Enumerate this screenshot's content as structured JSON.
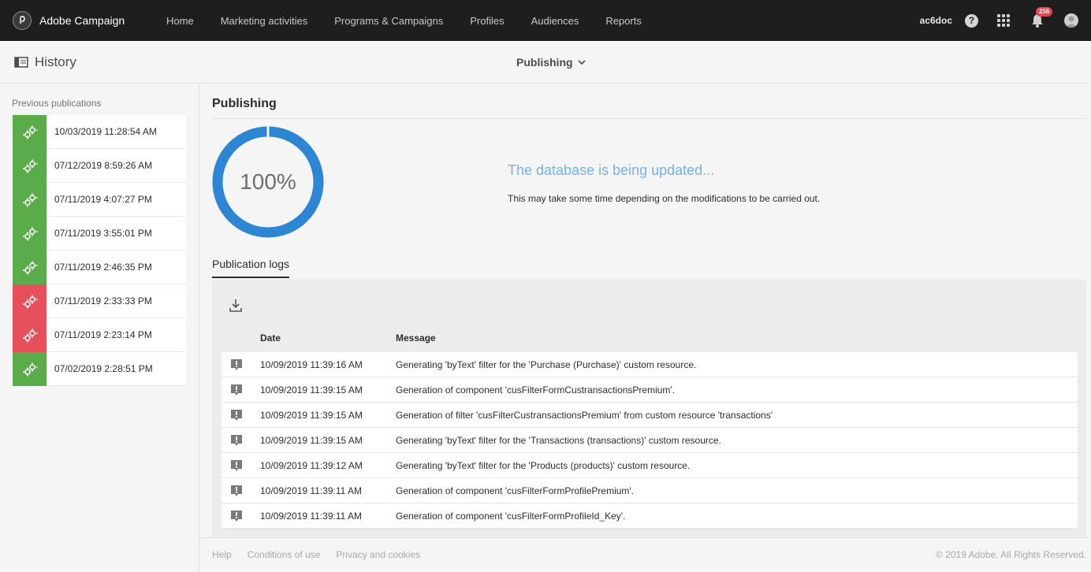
{
  "app": {
    "brand": "Adobe Campaign",
    "nav": [
      "Home",
      "Marketing activities",
      "Programs & Campaigns",
      "Profiles",
      "Audiences",
      "Reports"
    ],
    "user_code": "ac6doc",
    "help_glyph": "?",
    "notification_count": "256"
  },
  "header": {
    "history_title": "History",
    "publishing_label": "Publishing"
  },
  "sidebar": {
    "label": "Previous publications",
    "items": [
      {
        "date": "10/03/2019 11:28:54 AM",
        "status": "success"
      },
      {
        "date": "07/12/2019 8:59:26 AM",
        "status": "success"
      },
      {
        "date": "07/11/2019 4:07:27 PM",
        "status": "success"
      },
      {
        "date": "07/11/2019 3:55:01 PM",
        "status": "success"
      },
      {
        "date": "07/11/2019 2:46:35 PM",
        "status": "success"
      },
      {
        "date": "07/11/2019 2:33:33 PM",
        "status": "error"
      },
      {
        "date": "07/11/2019 2:23:14 PM",
        "status": "error"
      },
      {
        "date": "07/02/2019 2:28:51 PM",
        "status": "success"
      }
    ]
  },
  "main": {
    "title": "Publishing",
    "progress_percent": 100,
    "progress_label": "100%",
    "status_heading": "The database is being updated...",
    "status_text": "This may take some time depending on the modifications to be carried out.",
    "logs_tab": "Publication logs",
    "columns": {
      "date": "Date",
      "message": "Message"
    },
    "logs": [
      {
        "date": "10/09/2019 11:39:16 AM",
        "message": "Generating 'byText' filter for the 'Purchase (Purchase)' custom resource."
      },
      {
        "date": "10/09/2019 11:39:15 AM",
        "message": "Generation of component 'cusFilterFormCustransactionsPremium'."
      },
      {
        "date": "10/09/2019 11:39:15 AM",
        "message": "Generation of filter 'cusFilterCustransactionsPremium' from custom resource 'transactions'"
      },
      {
        "date": "10/09/2019 11:39:15 AM",
        "message": "Generating 'byText' filter for the 'Transactions (transactions)' custom resource."
      },
      {
        "date": "10/09/2019 11:39:12 AM",
        "message": "Generating 'byText' filter for the 'Products (products)' custom resource."
      },
      {
        "date": "10/09/2019 11:39:11 AM",
        "message": "Generation of component 'cusFilterFormProfilePremium'."
      },
      {
        "date": "10/09/2019 11:39:11 AM",
        "message": "Generation of component 'cusFilterFormProfileId_Key'."
      }
    ]
  },
  "footer": {
    "links": [
      "Help",
      "Conditions of use",
      "Privacy and cookies"
    ],
    "copyright": "© 2019 Adobe. All Rights Reserved."
  },
  "colors": {
    "accent_blue": "#2d86d4",
    "success": "#5aab4a",
    "error": "#e5505a",
    "topbar": "#1e1e1e"
  },
  "icons": {
    "brand": "adobe-campaign-logo-icon",
    "history": "sidebar-panel-icon",
    "dropdown": "chevron-down-icon",
    "help": "help-icon",
    "apps": "app-grid-icon",
    "notifications": "bell-icon",
    "avatar": "user-avatar-icon",
    "publication_status": "gears-icon",
    "download": "download-icon",
    "log_level": "warning-message-icon"
  }
}
